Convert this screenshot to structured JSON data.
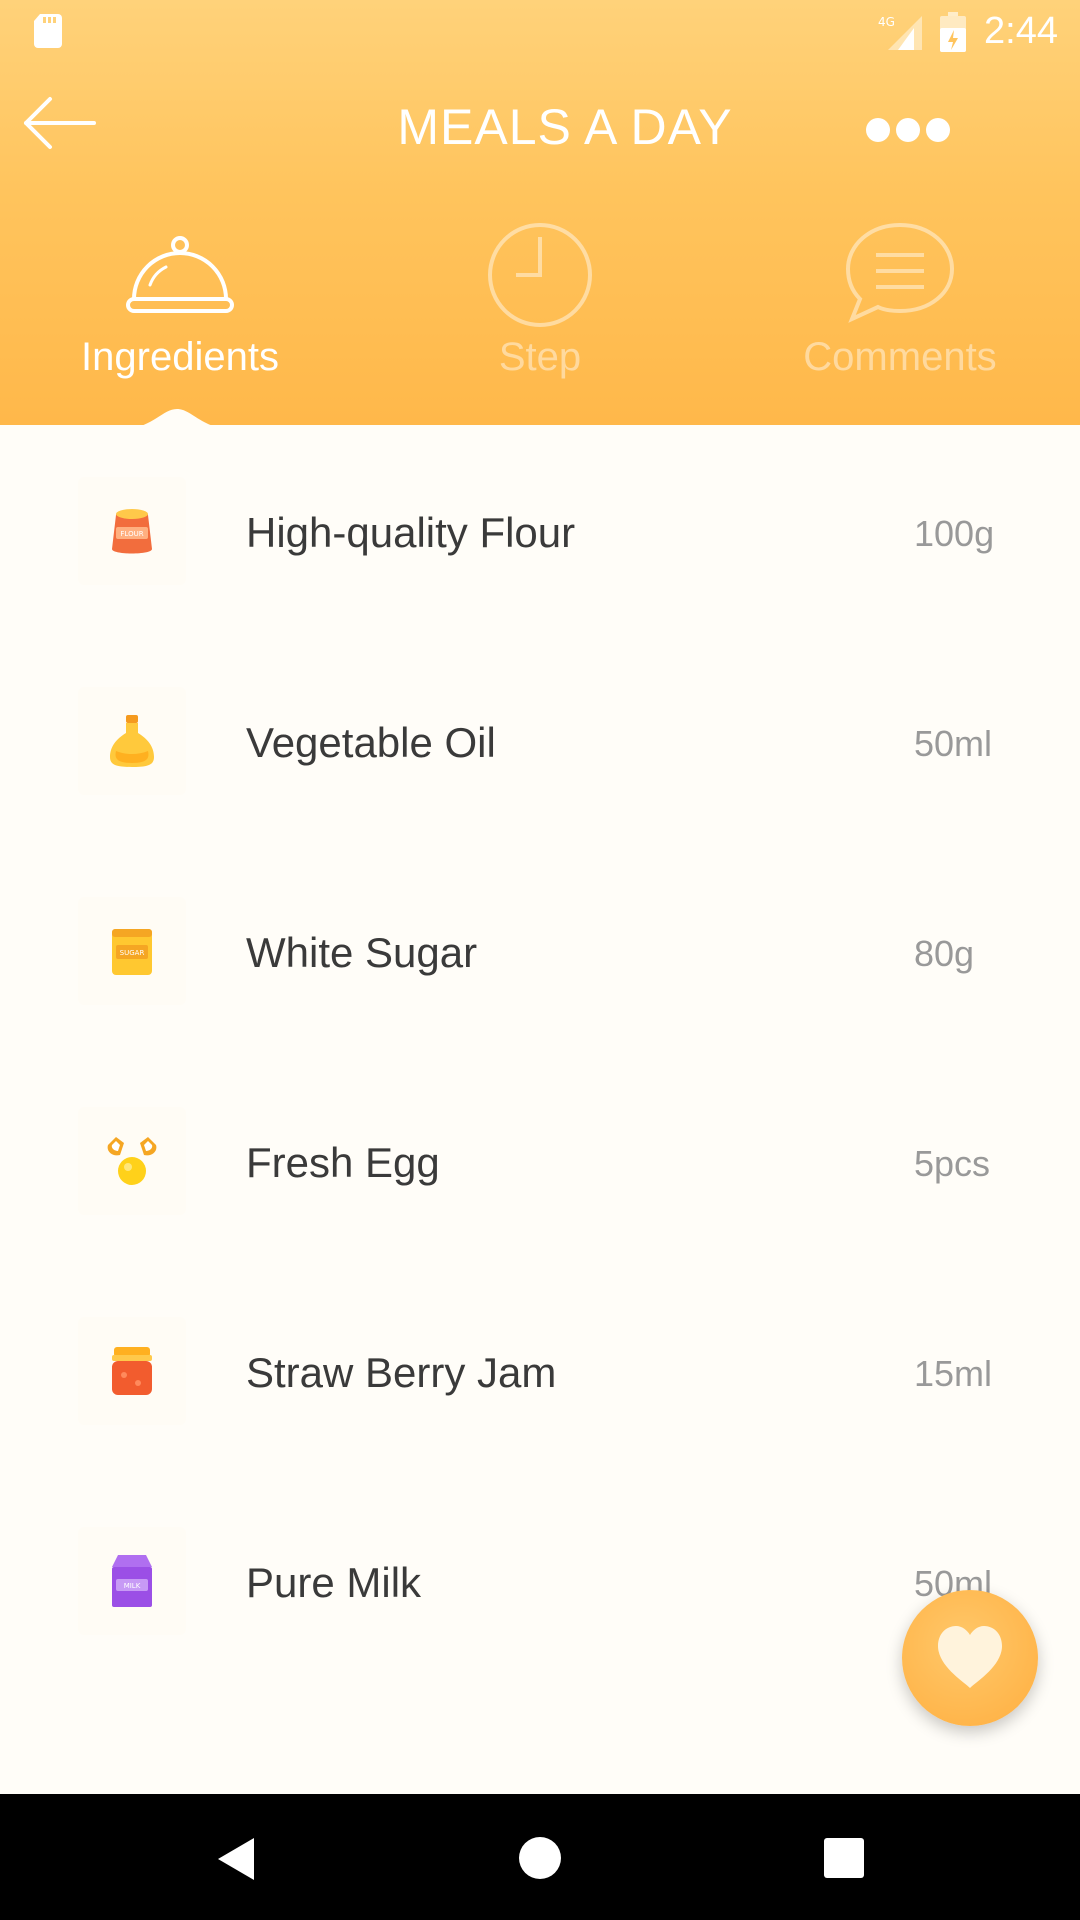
{
  "status_bar": {
    "time": "2:44",
    "network": "4G"
  },
  "app_bar": {
    "title": "MEALS A DAY",
    "back_icon": "arrow-left-icon",
    "more_icon": "more-dots-icon"
  },
  "tabs": [
    {
      "label": "Ingredients",
      "icon": "serving-cloche-icon",
      "active": true
    },
    {
      "label": "Step",
      "icon": "clock-icon",
      "active": false
    },
    {
      "label": "Comments",
      "icon": "chat-bubble-icon",
      "active": false
    }
  ],
  "ingredients": [
    {
      "name": "High-quality Flour",
      "qty": "100g",
      "icon": "flour-bag-icon",
      "icon_label": "FLOUR"
    },
    {
      "name": "Vegetable Oil",
      "qty": "50ml",
      "icon": "oil-bottle-icon"
    },
    {
      "name": "White Sugar",
      "qty": "80g",
      "icon": "sugar-box-icon",
      "icon_label": "SUGAR"
    },
    {
      "name": "Fresh Egg",
      "qty": "5pcs",
      "icon": "egg-icon"
    },
    {
      "name": "Straw Berry Jam",
      "qty": "15ml",
      "icon": "jam-jar-icon"
    },
    {
      "name": "Pure Milk",
      "qty": "50ml",
      "icon": "milk-carton-icon",
      "icon_label": "MILK"
    }
  ],
  "fab": {
    "icon": "heart-icon"
  },
  "colors": {
    "header_top": "#ffd27a",
    "header_bottom": "#ffb84a",
    "background": "#fffdf8",
    "text_primary": "#3a3a3a",
    "text_secondary": "#999999",
    "fab_heart": "#fff3dc"
  }
}
